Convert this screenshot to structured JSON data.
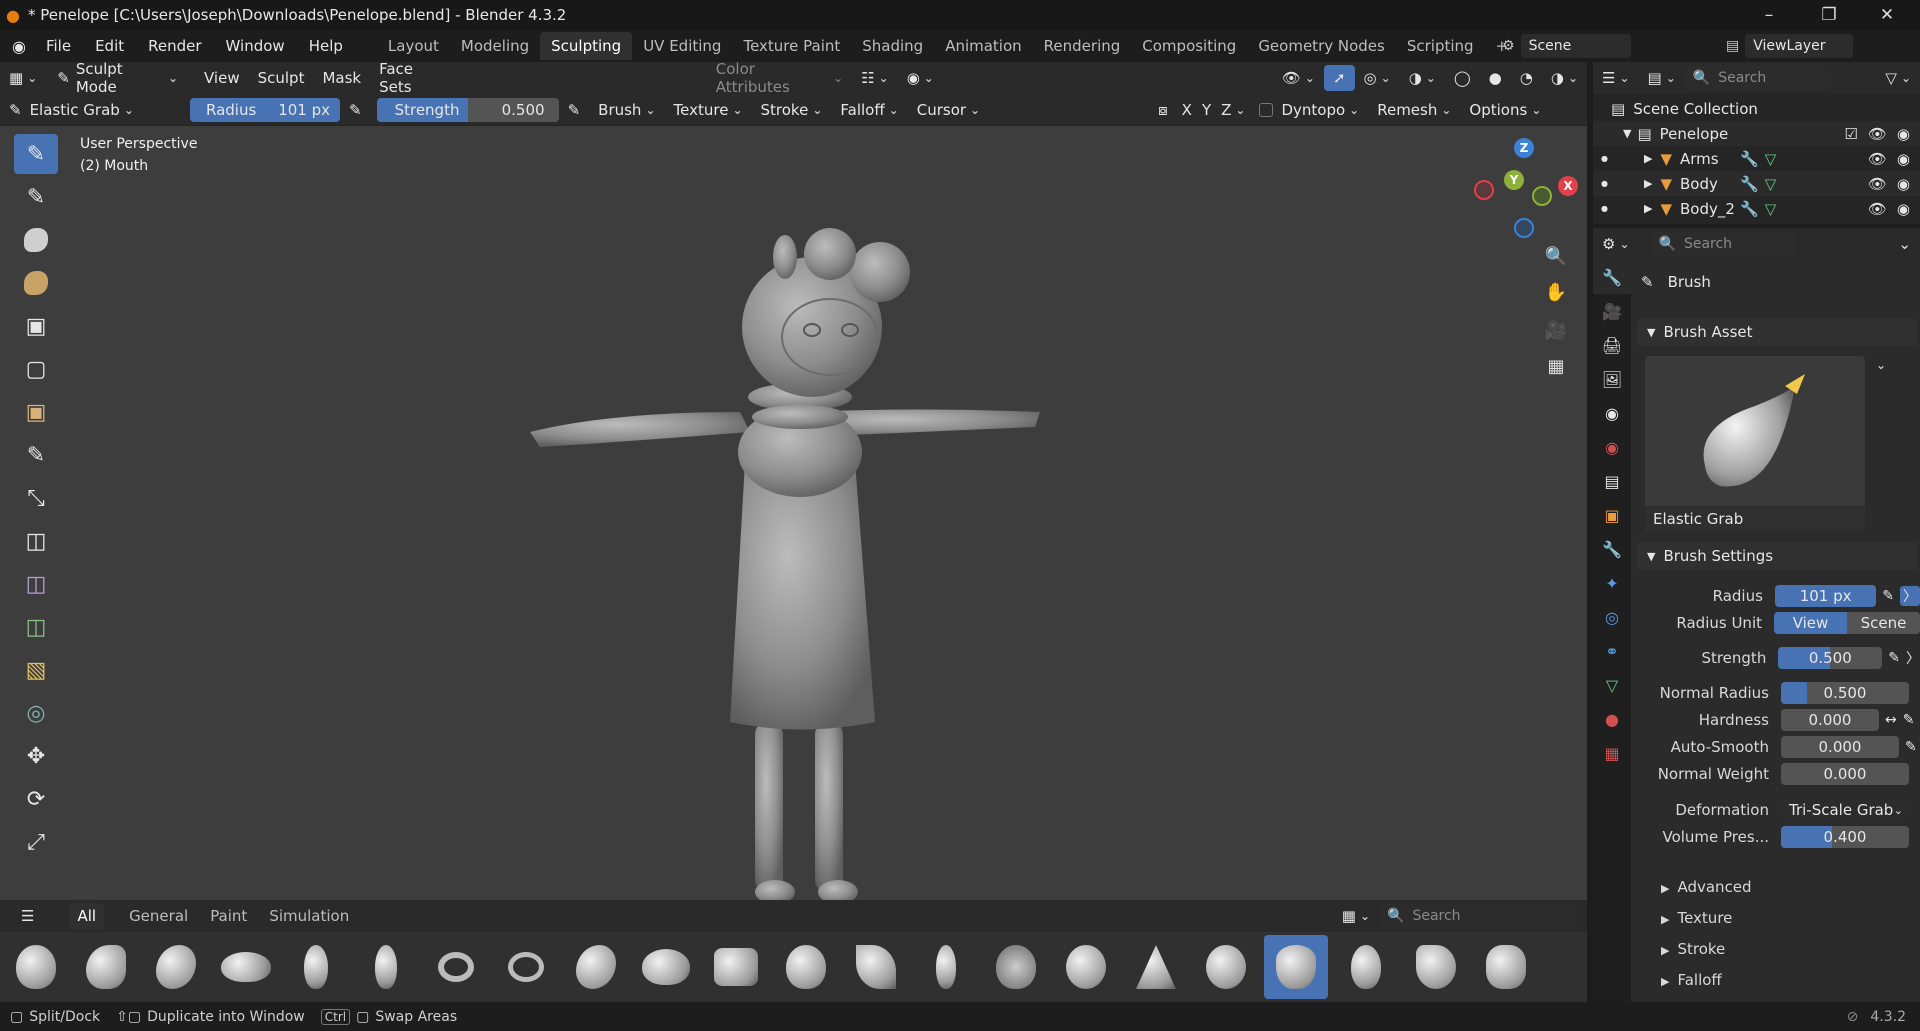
{
  "window": {
    "title": "* Penelope [C:\\Users\\Joseph\\Downloads\\Penelope.blend] - Blender 4.3.2"
  },
  "menu": [
    "File",
    "Edit",
    "Render",
    "Window",
    "Help"
  ],
  "workspaces": [
    "Layout",
    "Modeling",
    "Sculpting",
    "UV Editing",
    "Texture Paint",
    "Shading",
    "Animation",
    "Rendering",
    "Compositing",
    "Geometry Nodes",
    "Scripting"
  ],
  "active_workspace": "Sculpting",
  "scene": {
    "name": "Scene",
    "view_layer": "ViewLayer"
  },
  "viewport_header": {
    "mode": "Sculpt Mode",
    "menus": [
      "View",
      "Sculpt",
      "Mask",
      "Face Sets"
    ],
    "color_attributes": "Color Attributes"
  },
  "tool_header": {
    "brush": "Elastic Grab",
    "radius_label": "Radius",
    "radius_value": "101 px",
    "strength_label": "Strength",
    "strength_value": "0.500",
    "strength_fraction": 0.5,
    "popovers": [
      "Brush",
      "Texture",
      "Stroke",
      "Falloff",
      "Cursor"
    ],
    "axes": [
      "X",
      "Y",
      "Z"
    ],
    "dyntopo": "Dyntopo",
    "remesh": "Remesh",
    "options": "Options"
  },
  "viewport": {
    "perspective": "User Perspective",
    "object": "(2) Mouth"
  },
  "gizmo": {
    "x": "X",
    "y": "Y",
    "z": "Z"
  },
  "asset_shelf": {
    "tabs": [
      "All",
      "General",
      "Paint",
      "Simulation"
    ],
    "search_placeholder": "Search"
  },
  "statusbar": {
    "split": "Split/Dock",
    "duplicate": "Duplicate into Window",
    "ctrl": "Ctrl",
    "swap": "Swap Areas",
    "version": "4.3.2"
  },
  "outliner": {
    "search_placeholder": "Search",
    "root": "Scene Collection",
    "collection": "Penelope",
    "items": [
      "Arms",
      "Body",
      "Body_2"
    ]
  },
  "properties": {
    "search_placeholder": "Search",
    "section": "Brush",
    "brush_asset_title": "Brush Asset",
    "brush_asset_name": "Elastic Grab",
    "brush_settings_title": "Brush Settings",
    "radius_label": "Radius",
    "radius_value": "101 px",
    "radius_unit_label": "Radius Unit",
    "radius_unit_view": "View",
    "radius_unit_scene": "Scene",
    "strength_label": "Strength",
    "strength_value": "0.500",
    "strength_fraction": 0.5,
    "normal_radius_label": "Normal Radius",
    "normal_radius_value": "0.500",
    "normal_radius_fraction": 0.2,
    "hardness_label": "Hardness",
    "hardness_value": "0.000",
    "auto_smooth_label": "Auto-Smooth",
    "auto_smooth_value": "0.000",
    "normal_weight_label": "Normal Weight",
    "normal_weight_value": "0.000",
    "deformation_label": "Deformation",
    "deformation_value": "Tri-Scale Grab",
    "volume_label": "Volume Pres...",
    "volume_value": "0.400",
    "volume_fraction": 0.4,
    "subpanels": [
      "Advanced",
      "Texture",
      "Stroke",
      "Falloff"
    ]
  },
  "colors": {
    "accent": "#4772b3",
    "x_axis": "#e0414a",
    "y_axis": "#8cb038",
    "z_axis": "#3b82d6"
  }
}
